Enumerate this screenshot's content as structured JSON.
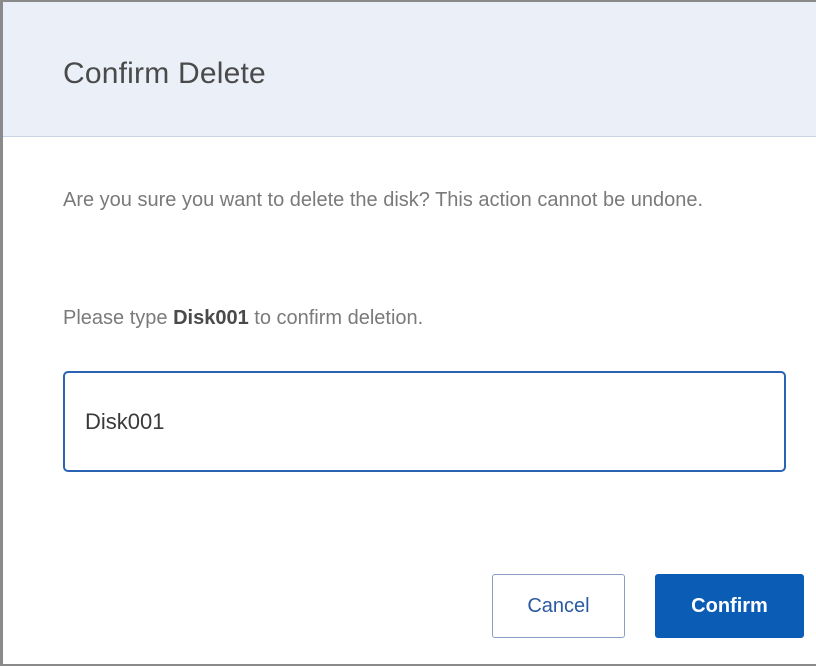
{
  "dialog": {
    "title": "Confirm Delete",
    "message": "Are you sure you want to delete the disk? This action cannot be undone.",
    "instruction_prefix": "Please type ",
    "instruction_name": "Disk001",
    "instruction_suffix": " to confirm deletion.",
    "input_value": "Disk001",
    "cancel_label": "Cancel",
    "confirm_label": "Confirm"
  },
  "colors": {
    "header_background": "#eaeff8",
    "primary": "#0b5cb5",
    "input_focus_border": "#2a63b3",
    "body_text": "#7a7a7a"
  }
}
